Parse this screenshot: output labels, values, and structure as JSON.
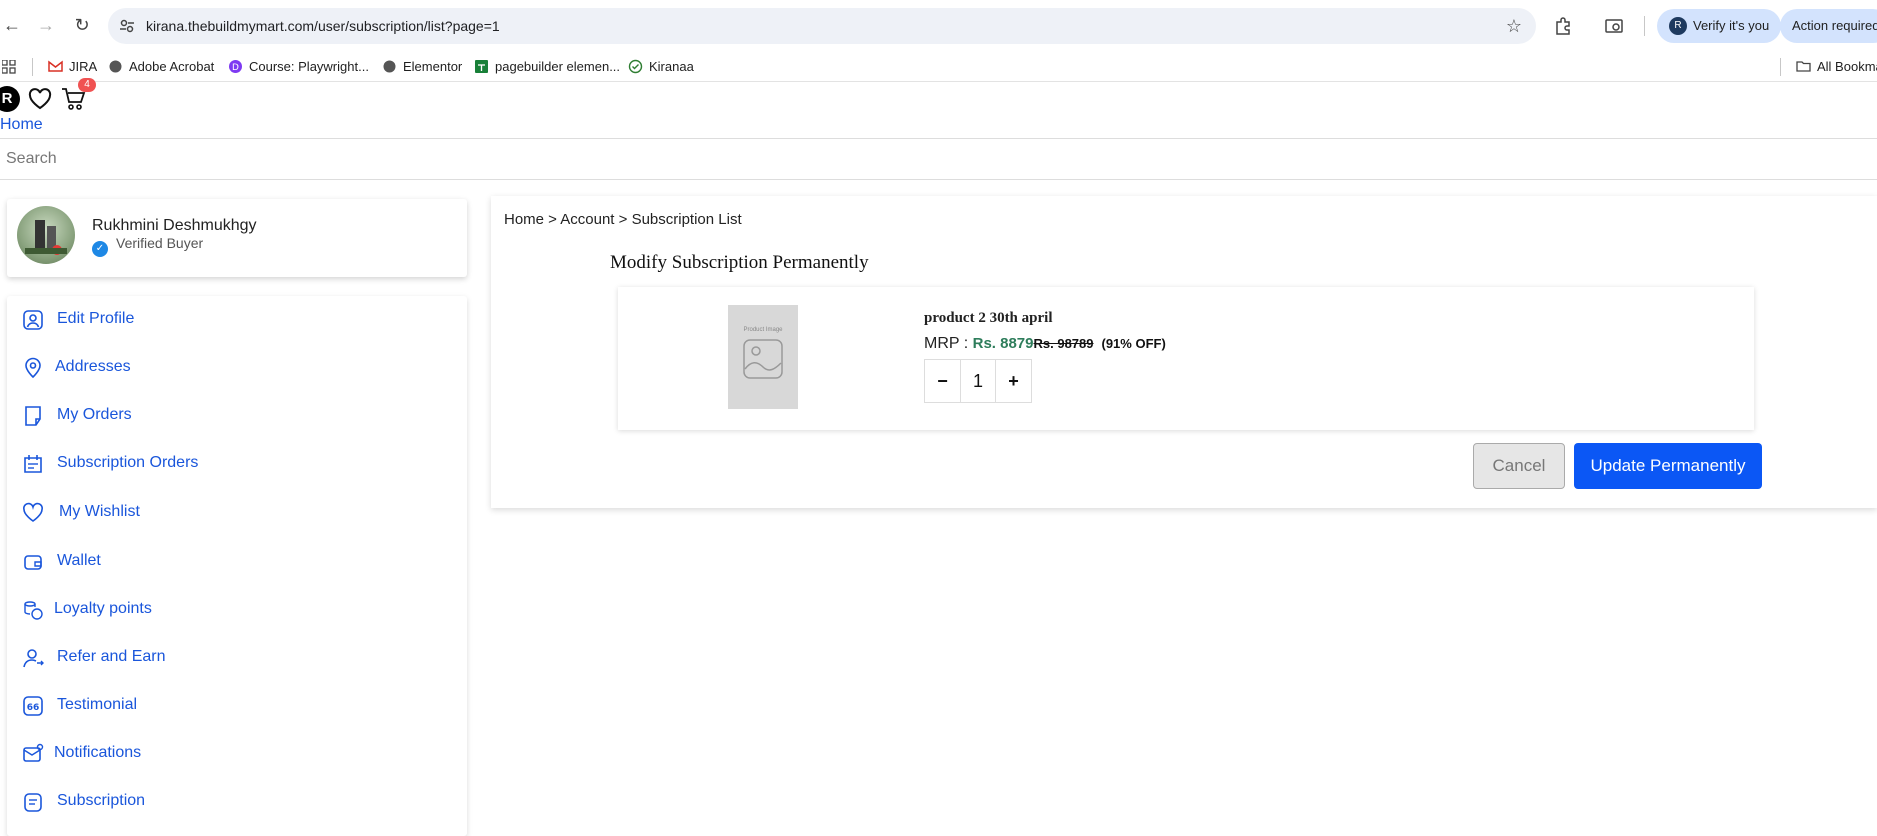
{
  "browser": {
    "url": "kirana.thebuildmymart.com/user/subscription/list?page=1",
    "pill_verify": "Verify it's you",
    "pill_action": "Action required",
    "pill_avatar": "R",
    "bookmarks": [
      {
        "label": "JIRA",
        "icon": "gmail-icon"
      },
      {
        "label": "Adobe Acrobat",
        "icon": "globe-icon"
      },
      {
        "label": "Course: Playwright...",
        "icon": "course-icon"
      },
      {
        "label": "Elementor",
        "icon": "globe-icon"
      },
      {
        "label": "pagebuilder elemen...",
        "icon": "sheets-icon"
      },
      {
        "label": "Kiranaa",
        "icon": "check-icon"
      }
    ],
    "all_bookmarks": "All Bookma"
  },
  "header": {
    "avatar_letter": "R",
    "cart_count": "4",
    "home_link": "Home",
    "search_placeholder": "Search"
  },
  "profile": {
    "name": "Rukhmini Deshmukhgy",
    "status": "Verified Buyer"
  },
  "menu": [
    {
      "label": "Edit Profile",
      "icon": "user-icon"
    },
    {
      "label": "Addresses",
      "icon": "location-pin-icon"
    },
    {
      "label": "My Orders",
      "icon": "orders-icon"
    },
    {
      "label": "Subscription Orders",
      "icon": "subscription-orders-icon"
    },
    {
      "label": "My Wishlist",
      "icon": "heart-icon"
    },
    {
      "label": "Wallet",
      "icon": "wallet-icon"
    },
    {
      "label": "Loyalty points",
      "icon": "coins-icon"
    },
    {
      "label": "Refer and Earn",
      "icon": "refer-icon"
    },
    {
      "label": "Testimonial",
      "icon": "quote-icon"
    },
    {
      "label": "Notifications",
      "icon": "mail-icon"
    },
    {
      "label": "Subscription",
      "icon": "subscription-icon"
    }
  ],
  "main": {
    "breadcrumb": "Home > Account > Subscription List",
    "title": "Modify Subscription Permanently",
    "product": {
      "image_label": "Product Image",
      "name": "product 2 30th april",
      "mrp_label": "MRP : ",
      "sale_price": "Rs. 8879",
      "original_price": "Rs. 98789",
      "discount": "(91% OFF)",
      "quantity": "1",
      "minus": "−",
      "plus": "+"
    },
    "cancel_label": "Cancel",
    "update_label": "Update Permanently"
  },
  "colors": {
    "link_blue": "#1a56db",
    "primary_button": "#0b57f5",
    "price_green": "#2e7d5b",
    "cart_badge": "#f05252"
  }
}
